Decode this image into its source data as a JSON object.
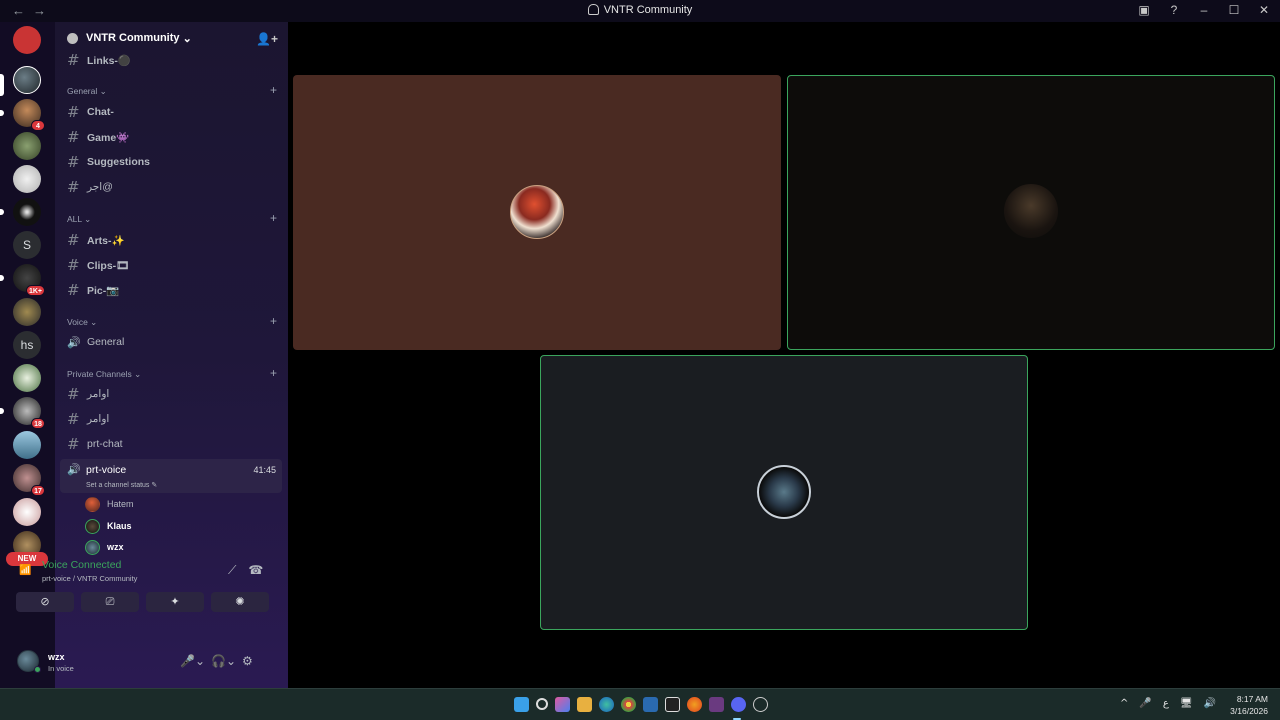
{
  "window": {
    "title": "VNTR Community",
    "nav_glyphs": "←→",
    "controls": [
      "▣",
      "?",
      "–",
      "☐",
      "✕"
    ]
  },
  "servers": {
    "letters": [
      "S",
      "hs"
    ],
    "badges": [
      "4",
      "1K+",
      "18",
      "17"
    ],
    "new_label": "NEW"
  },
  "guild": {
    "name": "VNTR Community",
    "chevron": "⌄",
    "invite_icon": "👤+"
  },
  "channels": {
    "top": [
      {
        "label": "Links-⚫"
      }
    ],
    "categories": [
      {
        "label": "General ⌄",
        "items": [
          {
            "label": "Chat-"
          },
          {
            "label": "Game👾"
          },
          {
            "label": "Suggestions"
          },
          {
            "label": "اجر@"
          }
        ]
      },
      {
        "label": "ALL ⌄",
        "items": [
          {
            "label": "Arts-✨"
          },
          {
            "label": "Clips-🎞"
          },
          {
            "label": "Pic-📷"
          }
        ]
      },
      {
        "label": "Voice ⌄",
        "items": [
          {
            "label": "General"
          }
        ]
      },
      {
        "label": "Private Channels ⌄",
        "items": [
          {
            "label": "اوامر"
          },
          {
            "label": "اوامر"
          },
          {
            "label": "prt-chat"
          }
        ]
      }
    ],
    "hash": "#",
    "speaker": "🔊",
    "plus": "+"
  },
  "active_voice": {
    "name": "prt-voice",
    "time": "41:45",
    "status": "Set a channel status ✎",
    "members": [
      {
        "name": "Hatem",
        "extra": "♟"
      },
      {
        "name": "Klaus"
      },
      {
        "name": "wzx"
      }
    ]
  },
  "voice_panel": {
    "title": "Voice Connected",
    "subtitle": "prt-voice / VNTR Community",
    "signal": "📶",
    "icon_noise": "⟋",
    "icon_disconnect": "☎",
    "buttons": [
      "⊘",
      "⎚",
      "✦",
      "✺"
    ]
  },
  "user": {
    "name": "wzx",
    "status": "In voice",
    "mic": "🎤⌄",
    "headset": "🎧⌄",
    "settings": "⚙"
  },
  "tiles": [
    {
      "name": "tile-hatem",
      "bg": "#4a2a22"
    },
    {
      "name": "tile-klaus",
      "bg": "#0d0c0a",
      "speaking": true
    },
    {
      "name": "tile-wzx",
      "bg": "#1a1d21",
      "speaking": true
    }
  ],
  "taskbar": {
    "tray": [
      "^",
      "🎤",
      "ع",
      "🖥",
      "🔊"
    ],
    "time": "8:17 AM",
    "date": "3/16/2026"
  },
  "colors": {
    "accent_green": "#3ba55d",
    "badge_red": "#da373c"
  }
}
